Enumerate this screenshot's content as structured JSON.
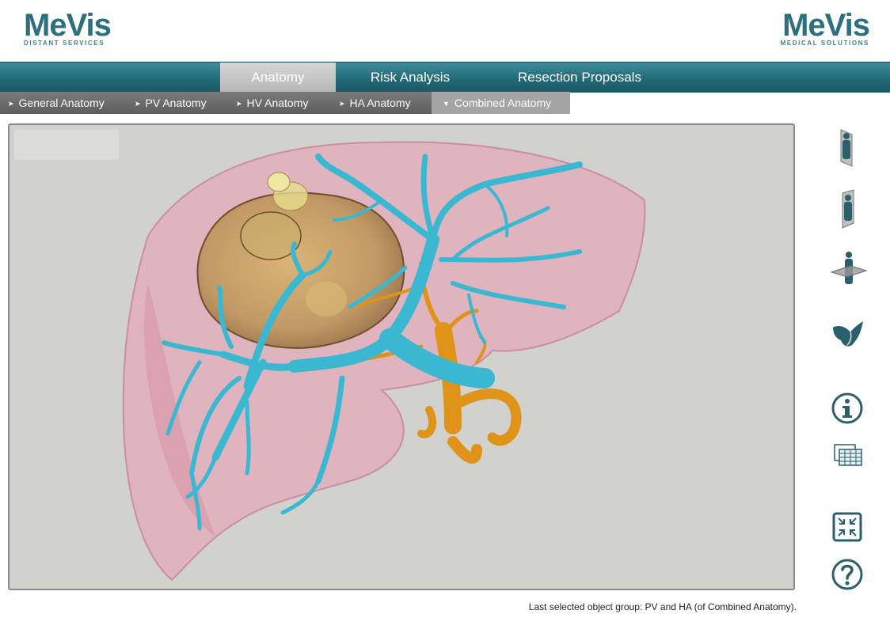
{
  "logos": {
    "left": {
      "word": "MeVis",
      "sub": "DISTANT SERVICES"
    },
    "right": {
      "word": "MeVis",
      "sub": "MEDICAL SOLUTIONS"
    }
  },
  "main_tabs": [
    {
      "label": "Anatomy",
      "active": true
    },
    {
      "label": "Risk Analysis",
      "active": false
    },
    {
      "label": "Resection Proposals",
      "active": false
    }
  ],
  "sub_tabs": [
    {
      "label": "General Anatomy",
      "arrow": "➤",
      "active": false
    },
    {
      "label": "PV Anatomy",
      "arrow": "➤",
      "active": false
    },
    {
      "label": "HV Anatomy",
      "arrow": "➤",
      "active": false
    },
    {
      "label": "HA Anatomy",
      "arrow": "➤",
      "active": false
    },
    {
      "label": "Combined Anatomy",
      "arrow": "▼",
      "active": true
    }
  ],
  "side_tools": [
    {
      "icon": "sagittal-view-icon"
    },
    {
      "icon": "coronal-view-icon"
    },
    {
      "icon": "axial-view-icon"
    },
    {
      "icon": "liver-3d-view-icon"
    },
    {
      "icon": "info-icon"
    },
    {
      "icon": "table-icon"
    },
    {
      "icon": "fit-to-screen-icon"
    },
    {
      "icon": "help-icon"
    }
  ],
  "status": {
    "text": "Last selected object group:  PV and HA (of Combined Anatomy)."
  },
  "colors": {
    "brand_teal": "#2d6f7e",
    "portal_vein": "#3fb6cf",
    "hepatic_artery": "#e0951e",
    "liver": "#e7aebe",
    "tumor": "#c7a15c"
  }
}
